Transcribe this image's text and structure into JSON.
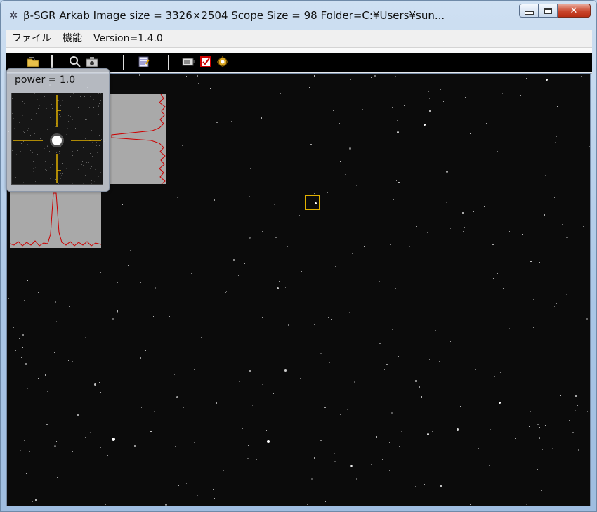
{
  "window": {
    "title": "β-SGR Arkab  Image size = 3326×2504  Scope Size = 98  Folder=C:¥Users¥sun...",
    "icon": "grid-app-icon"
  },
  "menu": {
    "items": [
      "ファイル",
      "機能",
      "Version=1.4.0"
    ]
  },
  "toolbar": {
    "icons": [
      "open-folder-icon",
      "zoom-icon",
      "camera-icon",
      "edit-document-icon",
      "battery-icon",
      "checkbox-icon",
      "settings-gear-icon"
    ]
  },
  "panel": {
    "label": "power = 1.0"
  },
  "colors": {
    "crosshair": "#e0b000",
    "profile_line": "#cc0000",
    "sky": "#0b0b0b"
  }
}
